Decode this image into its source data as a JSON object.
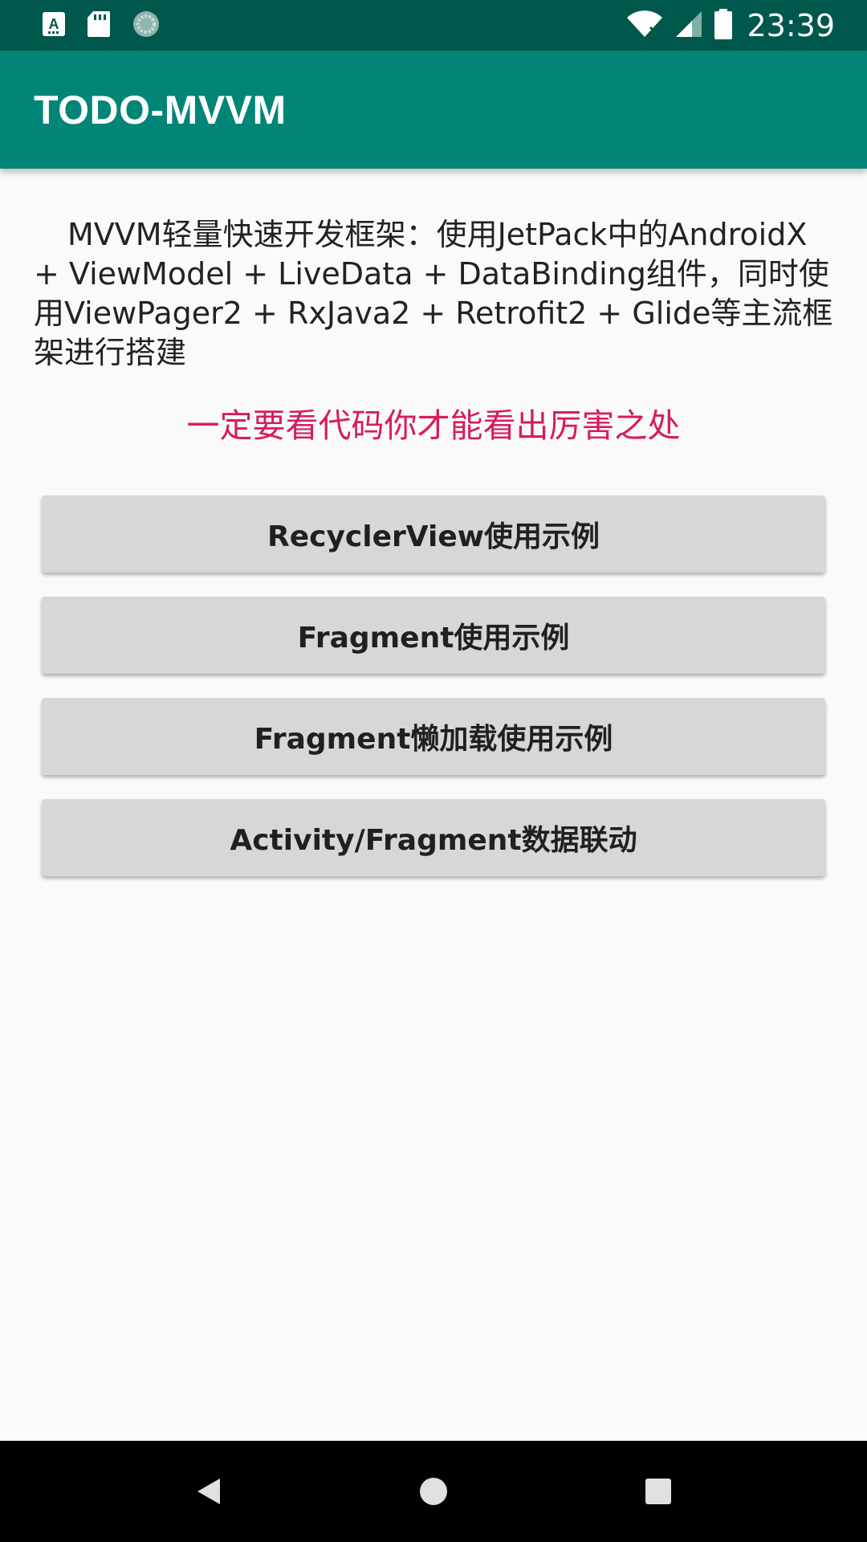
{
  "status_bar": {
    "time": "23:39",
    "icons": [
      "font-icon",
      "sd-card-icon",
      "sync-icon",
      "wifi-icon",
      "signal-icon",
      "battery-icon"
    ]
  },
  "app_bar": {
    "title": "TODO-MVVM",
    "background": "#008577"
  },
  "main": {
    "intro": "MVVM轻量快速开发框架：使用JetPack中的AndroidX + ViewModel + LiveData + DataBinding组件，同时使用ViewPager2 + RxJava2 + Retrofit2 + Glide等主流框架进行搭建",
    "warning": "一定要看代码你才能看出厉害之处",
    "warning_color": "#d81b60",
    "buttons": [
      {
        "label": "RecyclerView使用示例"
      },
      {
        "label": "Fragment使用示例"
      },
      {
        "label": "Fragment懒加载使用示例"
      },
      {
        "label": "Activity/Fragment数据联动"
      }
    ]
  },
  "nav_bar": {
    "icons": [
      "back-icon",
      "home-icon",
      "recents-icon"
    ]
  }
}
